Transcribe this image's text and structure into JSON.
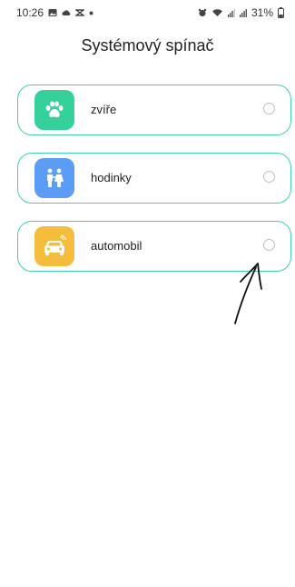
{
  "status_bar": {
    "time": "10:26",
    "battery": "31%",
    "left_icons": [
      "image-icon",
      "cloud-icon",
      "capcut-icon",
      "dot-icon"
    ],
    "right_icons": [
      "alarm-icon",
      "wifi-icon",
      "signal-icon",
      "signal-icon-2"
    ]
  },
  "page": {
    "title": "Systémový spínač"
  },
  "options": [
    {
      "label": "zvíře",
      "icon": "paw-icon",
      "color": "#34d29a",
      "selected": false
    },
    {
      "label": "hodinky",
      "icon": "people-icon",
      "color": "#5b9cf6",
      "selected": false
    },
    {
      "label": "automobil",
      "icon": "car-icon",
      "color": "#f5bd3b",
      "selected": false
    }
  ],
  "colors": {
    "card_border": "#3fd1b0"
  }
}
